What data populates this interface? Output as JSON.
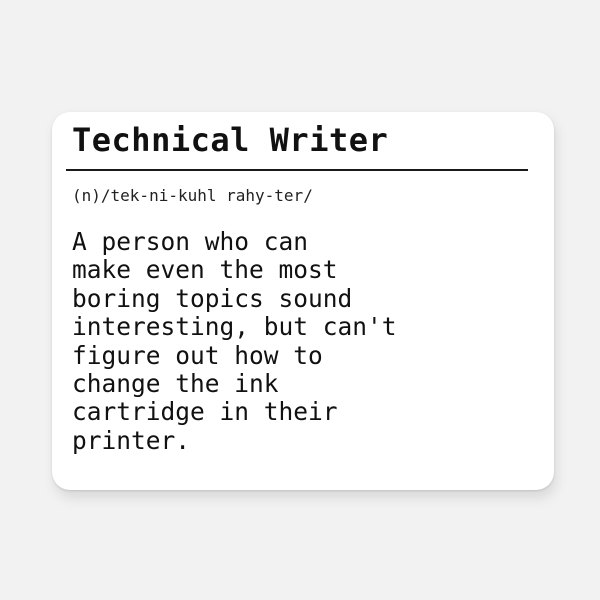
{
  "sticker": {
    "title": "Technical Writer",
    "pronunciation": "(n)/tek-ni-kuhl rahy-ter/",
    "definition": "A person who can\nmake even the most\nboring topics sound\ninteresting, but can't\nfigure out how to\nchange the ink\ncartridge in their\nprinter."
  },
  "colors": {
    "background": "#f2f2f2",
    "sticker": "#ffffff",
    "text": "#111111"
  }
}
